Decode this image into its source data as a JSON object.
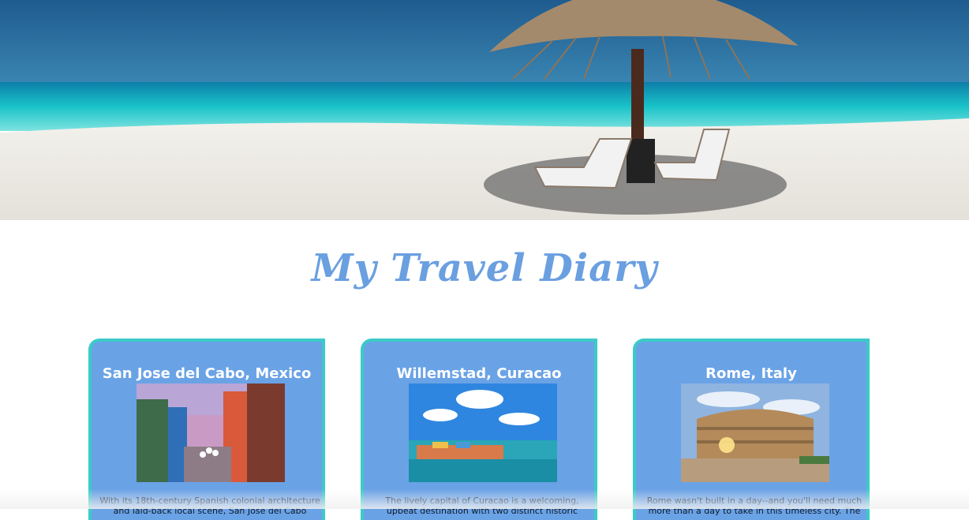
{
  "hero": {
    "image": "beach-umbrella-loungers-photo"
  },
  "title": "My Travel Diary",
  "cards": [
    {
      "title": "San Jose del Cabo, Mexico",
      "image": "san-jose-del-cabo-street-photo",
      "text": "With its 18th-century Spanish colonial architecture and laid-back local scene, San Jose del Cabo"
    },
    {
      "title": "Willemstad, Curacao",
      "image": "willemstad-waterfront-photo",
      "text": "The lively capital of Curacao is a welcoming, upbeat destination with two distinct historic"
    },
    {
      "title": "Rome, Italy",
      "image": "rome-colosseum-photo",
      "text": "Rome wasn't built in a day--and you'll need much more than a day to take in this timeless city. The"
    }
  ],
  "colors": {
    "title": "#6a9fe0",
    "card_background": "#6aa2e6",
    "card_border": "#3ccac8"
  }
}
